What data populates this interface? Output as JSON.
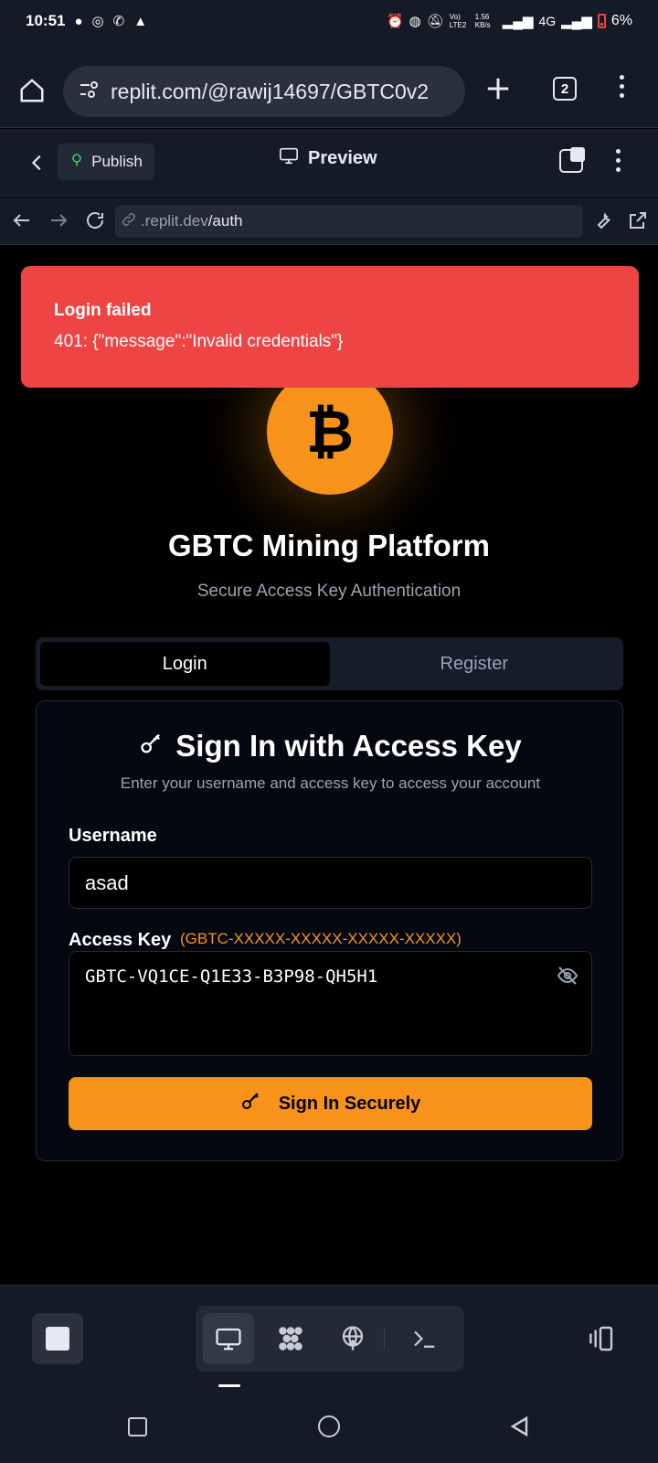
{
  "status_bar": {
    "time": "10:51",
    "net_speed": "1.56\nKB/s",
    "network": "4G",
    "volte": "Vo) LTE2",
    "battery": "6%"
  },
  "browser": {
    "url": "replit.com/@rawij14697/GBTC0v2",
    "tab_count": "2"
  },
  "replit_header": {
    "publish_label": "Publish",
    "preview_label": "Preview"
  },
  "address_bar": {
    "domain": ".replit.dev",
    "path": "/auth"
  },
  "toast": {
    "title": "Login failed",
    "message": "401: {\"message\":\"Invalid credentials\"}"
  },
  "app": {
    "logo_symbol": "₿",
    "title": "GBTC Mining Platform",
    "subtitle": "Secure Access Key Authentication"
  },
  "tabs": [
    {
      "label": "Login",
      "active": true
    },
    {
      "label": "Register",
      "active": false
    }
  ],
  "form": {
    "title": "Sign In with Access Key",
    "description": "Enter your username and access key to access your account",
    "username_label": "Username",
    "username_value": "asad",
    "access_key_label": "Access Key",
    "access_key_hint": "(GBTC-XXXXX-XXXXX-XXXXX-XXXXX)",
    "access_key_value": "GBTC-VQ1CE-Q1E33-B3P98-QH5H1",
    "submit_label": "Sign In Securely"
  },
  "colors": {
    "accent": "#f7931a",
    "error": "#ef4444",
    "bar_bg": "#151b26"
  }
}
